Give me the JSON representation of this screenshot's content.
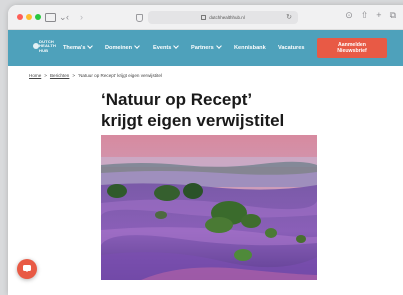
{
  "browser": {
    "url": "dutchhealthhub.nl"
  },
  "nav": {
    "logo_lines": [
      "DUTCH",
      "HEALTH",
      "HUB"
    ],
    "items": [
      {
        "label": "Thema's",
        "has_dropdown": true
      },
      {
        "label": "Domeinen",
        "has_dropdown": true
      },
      {
        "label": "Events",
        "has_dropdown": true
      },
      {
        "label": "Partners",
        "has_dropdown": true
      },
      {
        "label": "Kennisbank",
        "has_dropdown": false
      },
      {
        "label": "Vacatures",
        "has_dropdown": false
      }
    ],
    "cta_line1": "Aanmelden",
    "cta_line2": "Nieuwsbrief"
  },
  "breadcrumb": {
    "home": "Home",
    "section": "Berichten",
    "current": "‘Natuur op Recept’ krijgt eigen verwijstitel"
  },
  "article": {
    "title_line1": "‘Natuur op Recept’",
    "title_line2": "krijgt eigen verwijstitel"
  },
  "colors": {
    "nav_bg": "#4ea1bb",
    "cta_bg": "#e85a45",
    "chat_bg": "#e85a45"
  },
  "icons": {
    "chat": "chat-bubble-icon"
  }
}
